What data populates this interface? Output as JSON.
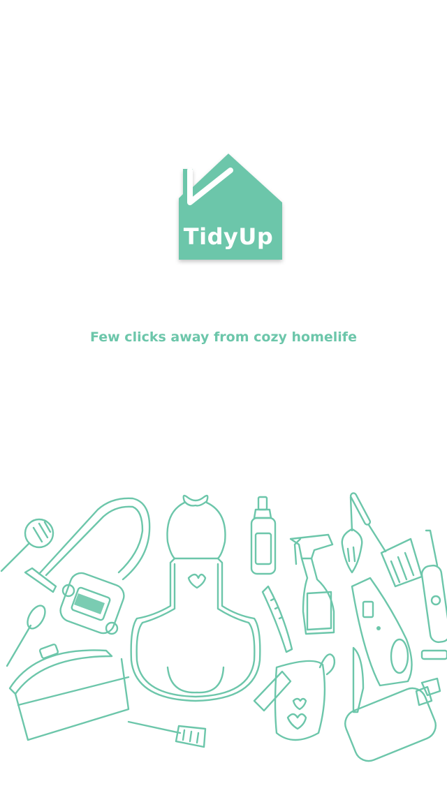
{
  "app": {
    "name": "TidyUp",
    "tagline": "Few clicks away from cozy homelife",
    "brand_color": "#6cc6aa"
  },
  "illustration": {
    "items": [
      "skimmer-icon",
      "vacuum-cleaner-icon",
      "apron-icon",
      "spray-bottle-icon",
      "dish-soap-icon",
      "spatula-icon",
      "handheld-vacuum-icon",
      "steam-mop-icon",
      "ladle-icon",
      "cooking-pot-icon",
      "knife-icon",
      "oven-mitt-icon",
      "soap-dispenser-icon"
    ]
  }
}
